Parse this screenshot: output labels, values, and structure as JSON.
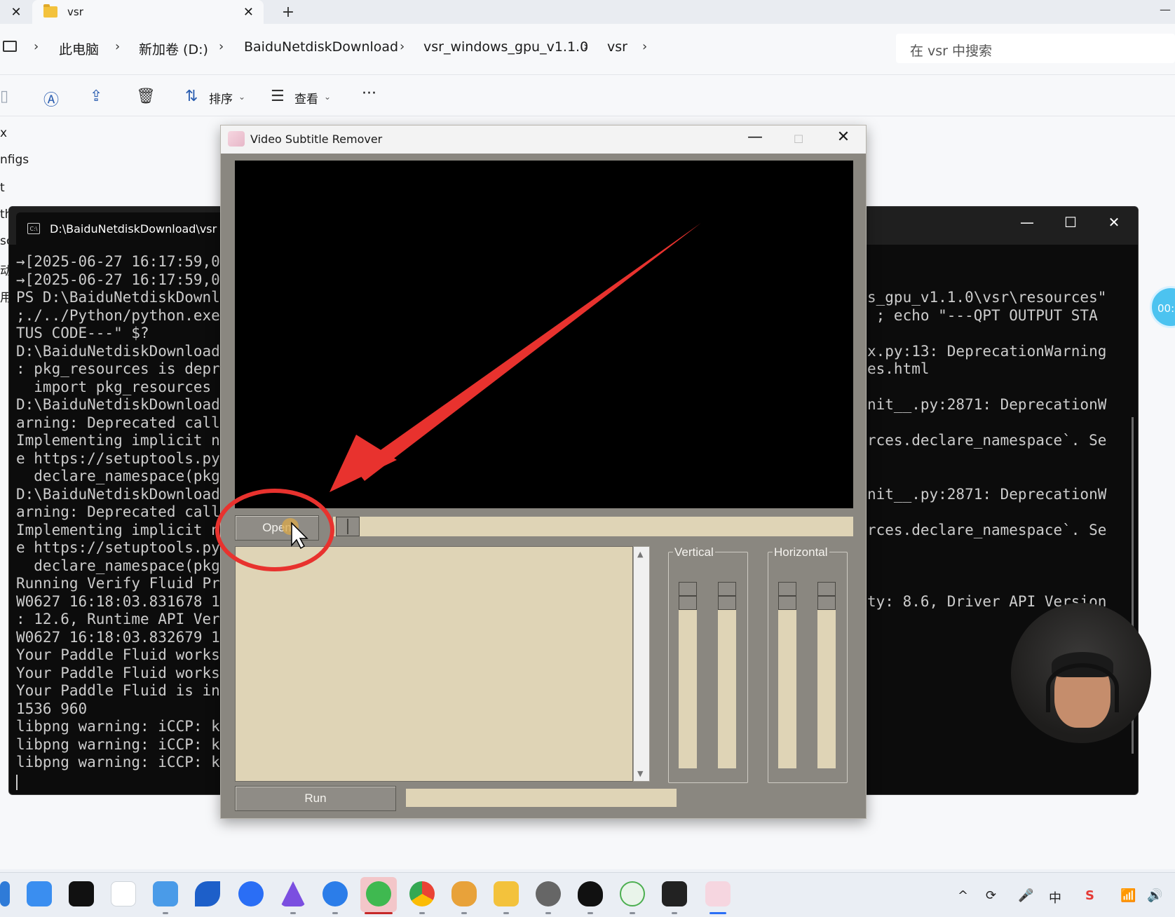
{
  "explorer": {
    "tab_title": "vsr",
    "tab_close": "✕",
    "prev_tab_close": "✕",
    "new_tab": "+",
    "window_min": "—",
    "breadcrumb": [
      "此电脑",
      "新加卷 (D:)",
      "BaiduNetdiskDownload",
      "vsr_windows_gpu_v1.1.0",
      "vsr"
    ],
    "chevron": "›",
    "search_placeholder": "在 vsr 中搜索",
    "toolbar": {
      "sort_label": "排序",
      "view_label": "查看",
      "more_label": "···"
    },
    "nav_items": [
      "x",
      "nfigs",
      "t",
      "th",
      "sc",
      "动",
      "用"
    ]
  },
  "terminal": {
    "tab_title": "D:\\BaiduNetdiskDownload\\vsr",
    "controls": {
      "min": "—",
      "max": "☐",
      "close": "✕"
    },
    "left_lines": [
      "→[2025-06-27 16:17:59,0",
      "→[2025-06-27 16:17:59,0",
      "PS D:\\BaiduNetdiskDownl",
      ";./../Python/python.exe",
      "TUS CODE---\" $?",
      "D:\\BaiduNetdiskDownload",
      ": pkg_resources is depr",
      "  import pkg_resources",
      "D:\\BaiduNetdiskDownload",
      "arning: Deprecated call",
      "Implementing implicit n",
      "e https://setuptools.py",
      "  declare_namespace(pkg",
      "D:\\BaiduNetdiskDownload",
      "arning: Deprecated call",
      "Implementing implicit n",
      "e https://setuptools.py",
      "  declare_namespace(pkg",
      "Running Verify Fluid Pr",
      "W0627 16:18:03.831678 1",
      ": 12.6, Runtime API Ver",
      "W0627 16:18:03.832679 1",
      "Your Paddle Fluid works",
      "Your Paddle Fluid works",
      "Your Paddle Fluid is in",
      "1536 960",
      "libpng warning: iCCP: k",
      "libpng warning: iCCP: k",
      "libpng warning: iCCP: k"
    ],
    "right_lines": [
      {
        "row": 2,
        "text": "s_gpu_v1.1.0\\vsr\\resources\""
      },
      {
        "row": 3,
        "text": " ; echo \"---QPT OUTPUT STA"
      },
      {
        "row": 5,
        "text": "x.py:13: DeprecationWarning"
      },
      {
        "row": 6,
        "text": "es.html"
      },
      {
        "row": 8,
        "text": "nit__.py:2871: DeprecationW"
      },
      {
        "row": 10,
        "text": "rces.declare_namespace`. Se"
      },
      {
        "row": 13,
        "text": "nit__.py:2871: DeprecationW"
      },
      {
        "row": 15,
        "text": "rces.declare_namespace`. Se"
      },
      {
        "row": 19,
        "text": "ty: 8.6, Driver API Version"
      }
    ]
  },
  "vsr": {
    "title": "Video Subtitle Remover",
    "controls": {
      "min": "—",
      "max": "☐",
      "close": "✕"
    },
    "open_label": "Open",
    "run_label": "Run",
    "vertical_label": "Vertical",
    "horizontal_label": "Horizontal",
    "scroll_up": "▲",
    "scroll_down": "▼"
  },
  "overlay": {
    "timer_text": "00:"
  },
  "taskbar": {
    "tray": [
      "^",
      "⟳",
      "🎤",
      "中",
      "S",
      "📶",
      "🔊"
    ]
  },
  "colors": {
    "annotation_red": "#e8322e",
    "panel_beige": "#dfd4b6",
    "window_gray": "#8a8780",
    "terminal_bg": "#0c0c0c"
  }
}
